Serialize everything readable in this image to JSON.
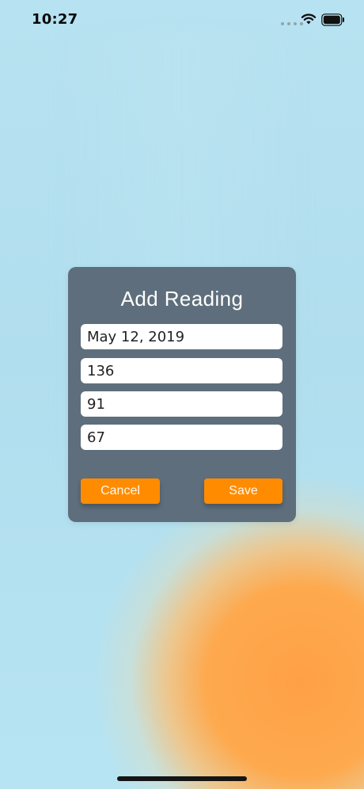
{
  "status_bar": {
    "time": "10:27",
    "signal_icon": "cellular-signal-dots",
    "wifi_icon": "wifi-icon",
    "battery_icon": "battery-full-icon"
  },
  "dialog": {
    "title": "Add Reading",
    "fields": {
      "date": "May 12, 2019",
      "systolic": "136",
      "diastolic": "91",
      "pulse": "67"
    },
    "buttons": {
      "cancel": "Cancel",
      "save": "Save"
    }
  },
  "colors": {
    "background": "#b3e0ef",
    "dialog": "#5e6e7c",
    "accent": "#ff8c00",
    "decorative_orb": "#ffa04a"
  }
}
